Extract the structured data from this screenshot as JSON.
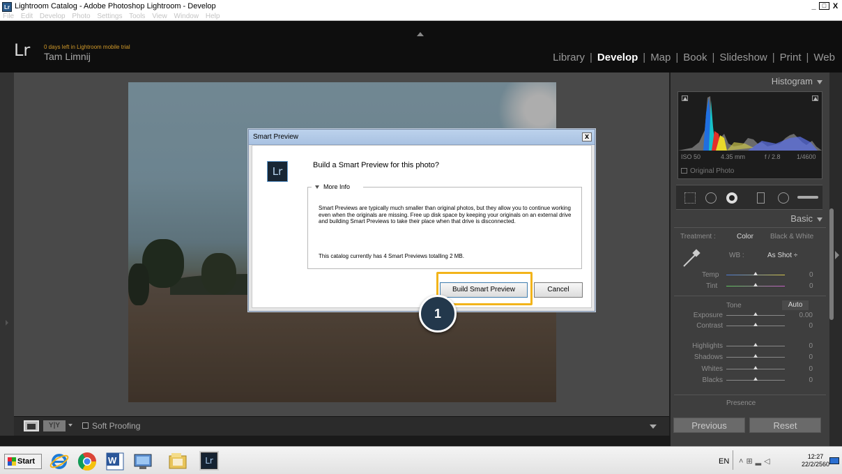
{
  "window": {
    "title": "Lightroom Catalog - Adobe Photoshop Lightroom - Develop",
    "icon_label": "Lr",
    "menus": [
      "File",
      "Edit",
      "Develop",
      "Photo",
      "Settings",
      "Tools",
      "View",
      "Window",
      "Help"
    ],
    "controls": [
      "_",
      "□",
      "X"
    ]
  },
  "header": {
    "logo": "Lr",
    "trial_notice": "0 days left in Lightroom mobile trial",
    "user_name": "Tam Limnij",
    "modules": [
      "Library",
      "Develop",
      "Map",
      "Book",
      "Slideshow",
      "Print",
      "Web"
    ],
    "active_module": "Develop",
    "separator": "|"
  },
  "toolbar": {
    "view_glyph": "Y|Y",
    "soft_proofing_label": "Soft Proofing"
  },
  "right_panel": {
    "histogram_title": "Histogram",
    "meta": {
      "iso": "ISO 50",
      "focal": "4.35 mm",
      "aperture": "f / 2.8",
      "shutter": "1/4600"
    },
    "original_photo_label": "Original Photo",
    "basic_title": "Basic",
    "treatment_label": "Treatment :",
    "treatment_color": "Color",
    "treatment_bw": "Black & White",
    "wb_label": "WB :",
    "wb_value": "As Shot ÷",
    "temp_label": "Temp",
    "temp_value": "0",
    "tint_label": "Tint",
    "tint_value": "0",
    "tone_label": "Tone",
    "auto_label": "Auto",
    "sliders": [
      {
        "label": "Exposure",
        "value": "0.00"
      },
      {
        "label": "Contrast",
        "value": "0"
      },
      {
        "label": "Highlights",
        "value": "0"
      },
      {
        "label": "Shadows",
        "value": "0"
      },
      {
        "label": "Whites",
        "value": "0"
      },
      {
        "label": "Blacks",
        "value": "0"
      }
    ],
    "presence_label": "Presence",
    "previous_label": "Previous",
    "reset_label": "Reset"
  },
  "dialog": {
    "title": "Smart Preview",
    "close": "x",
    "icon_label": "Lr",
    "question": "Build a Smart Preview for this photo?",
    "more_info_label": "More Info",
    "info_text": "Smart Previews are typically much smaller than original photos, but they allow you to continue working even when the originals are missing. Free up disk space by keeping your originals on an external drive and building Smart Previews to take their place when that drive is disconnected.",
    "count_text": "This catalog currently has 4 Smart Previews totalling 2 MB.",
    "build_button": "Build Smart Preview",
    "cancel_button": "Cancel"
  },
  "annotation": {
    "step_number": "1",
    "highlight_color": "#f2b41b"
  },
  "taskbar": {
    "start_label": "Start",
    "language": "EN",
    "time": "12:27",
    "date": "22/2/2560",
    "apps": [
      "internet-explorer-icon",
      "chrome-icon",
      "word-icon",
      "remote-desktop-icon",
      "file-explorer-icon",
      "lightroom-icon"
    ]
  },
  "colors": {
    "accent_orange": "#f2b41b",
    "badge_navy": "#23384c",
    "trial_text": "#d39b2a"
  }
}
